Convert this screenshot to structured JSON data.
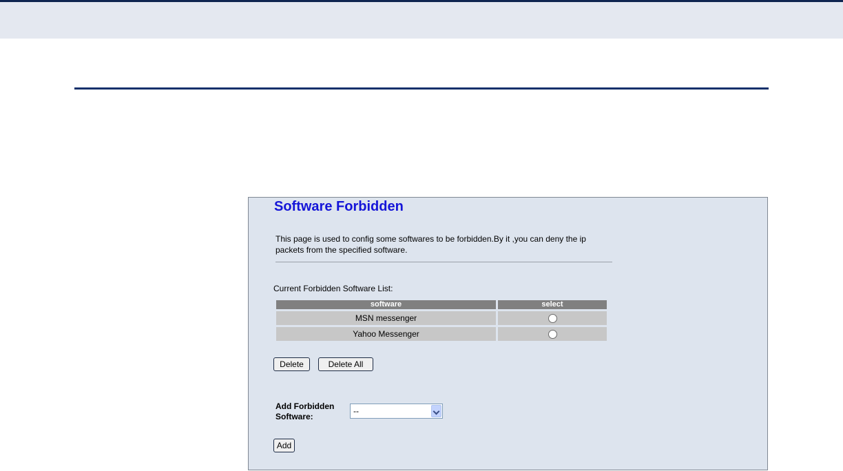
{
  "page": {
    "title": "Software Forbidden",
    "description": "This page is used to config some softwares to be forbidden.By it ,you can deny the ip packets from the specified software."
  },
  "list": {
    "caption": "Current Forbidden Software List:",
    "columns": [
      "software",
      "select"
    ],
    "rows": [
      {
        "software": "MSN messenger",
        "selected": false
      },
      {
        "software": "Yahoo Messenger",
        "selected": false
      }
    ]
  },
  "buttons": {
    "delete": "Delete",
    "delete_all": "Delete All",
    "add": "Add"
  },
  "add_form": {
    "label": "Add Forbidden Software:",
    "select_value": "--"
  },
  "colors": {
    "title": "#1515d8",
    "panel_background": "#dde4ee",
    "header_background": "#808080",
    "row_background": "#c7c7c7",
    "accent_line": "#13306b"
  },
  "icons": {
    "select_arrow": "chevron-down-icon",
    "row_select": "radio-button"
  }
}
